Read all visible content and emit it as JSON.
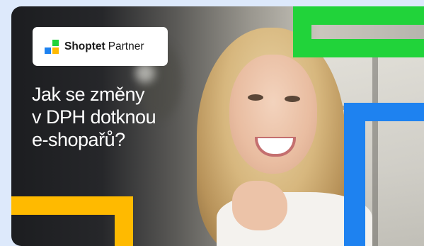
{
  "badge": {
    "logo": "shoptet-logo",
    "brand": "Shoptet",
    "suffix": "Partner"
  },
  "headline": {
    "lines": [
      "Jak se změny",
      "v DPH dotknou",
      "e-shopařů?"
    ]
  },
  "colors": {
    "page_background": "#dde9fb",
    "green": "#21d33a",
    "blue": "#1e82f0",
    "yellow": "#ffba00",
    "logo_blue": "#1e82f0",
    "logo_green": "#21d33a",
    "logo_yellow": "#ffba00"
  }
}
